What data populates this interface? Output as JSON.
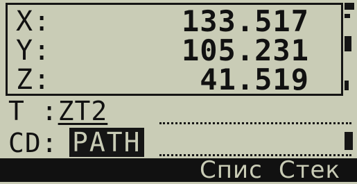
{
  "coordinates": {
    "x": {
      "label": "X:",
      "value": "133.517"
    },
    "y": {
      "label": "Y:",
      "value": "105.231"
    },
    "z": {
      "label": "Z:",
      "value": "41.519"
    }
  },
  "target": {
    "label": "T :",
    "value": "ZT2"
  },
  "code": {
    "label": "CD:",
    "value": "PATH"
  },
  "softkeys": [
    {
      "label": "Спис"
    },
    {
      "label": "Стек"
    }
  ],
  "colors": {
    "background": "#c9ccb6",
    "foreground": "#151515"
  }
}
